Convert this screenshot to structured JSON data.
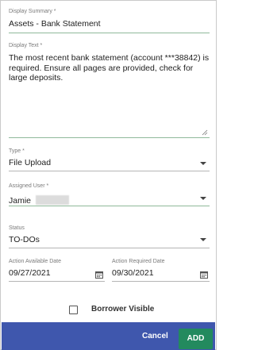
{
  "form": {
    "display_summary": {
      "label": "Display Summary *",
      "value": "Assets - Bank Statement"
    },
    "display_text": {
      "label": "Display Text *",
      "value": "The most recent bank statement (account ***38842) is required. Ensure all pages are provided, check for large deposits."
    },
    "type": {
      "label": "Type *",
      "value": "File Upload"
    },
    "assigned_user": {
      "label": "Assigned User *",
      "value": "Jamie"
    },
    "status": {
      "label": "Status",
      "value": "TO-DOs"
    },
    "action_available_date": {
      "label": "Action Available Date",
      "value": "09/27/2021"
    },
    "action_required_date": {
      "label": "Action Required Date",
      "value": "09/30/2021"
    },
    "borrower_visible": {
      "label": "Borrower Visible",
      "checked": false
    }
  },
  "footer": {
    "cancel_label": "Cancel",
    "add_label": "ADD"
  },
  "icons": {
    "dropdown": "chevron-down-icon",
    "calendar": "calendar-icon",
    "resize": "resize-handle-icon"
  },
  "colors": {
    "footer_bg": "#3f57ad",
    "add_button": "#238a5e",
    "active_underline": "#8fb99a"
  }
}
